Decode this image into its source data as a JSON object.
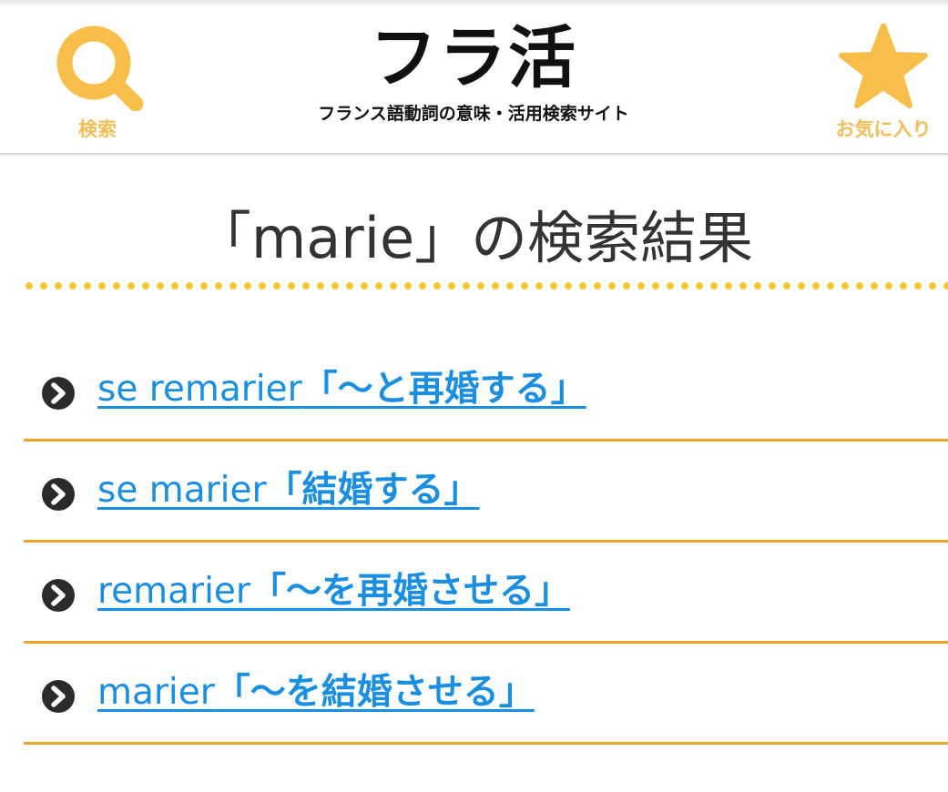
{
  "header": {
    "title": "フラ活",
    "subtitle": "フランス語動詞の意味・活用検索サイト",
    "search_label": "検索",
    "favorites_label": "お気に入り",
    "search_icon": "search-icon",
    "favorites_icon": "star-icon"
  },
  "main": {
    "heading": "「marie」の検索結果",
    "results": [
      {
        "verb": "se remarier",
        "meaning": "「～と再婚する」"
      },
      {
        "verb": "se marier",
        "meaning": "「結婚する」"
      },
      {
        "verb": "remarier",
        "meaning": "「～を再婚させる」"
      },
      {
        "verb": "marier",
        "meaning": "「～を結婚させる」"
      }
    ]
  },
  "colors": {
    "accent_yellow": "#f4c431",
    "nav_icon": "#f7bf4a",
    "link_blue": "#1a8ee0",
    "divider_orange": "#e8a52a"
  }
}
